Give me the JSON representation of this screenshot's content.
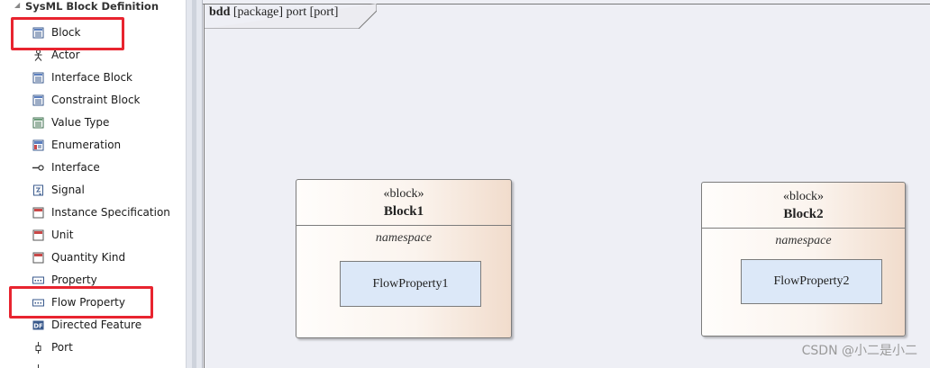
{
  "toolbox": {
    "section_title": "SysML Block Definition",
    "items": [
      {
        "label": "Block",
        "icon": "block-icon"
      },
      {
        "label": "Actor",
        "icon": "actor-icon"
      },
      {
        "label": "Interface Block",
        "icon": "interface-block-icon"
      },
      {
        "label": "Constraint Block",
        "icon": "constraint-block-icon"
      },
      {
        "label": "Value Type",
        "icon": "value-type-icon"
      },
      {
        "label": "Enumeration",
        "icon": "enumeration-icon"
      },
      {
        "label": "Interface",
        "icon": "interface-icon"
      },
      {
        "label": "Signal",
        "icon": "signal-icon"
      },
      {
        "label": "Instance Specification",
        "icon": "instance-specification-icon"
      },
      {
        "label": "Unit",
        "icon": "unit-icon"
      },
      {
        "label": "Quantity Kind",
        "icon": "quantity-kind-icon"
      },
      {
        "label": "Property",
        "icon": "property-icon"
      },
      {
        "label": "Flow Property",
        "icon": "flow-property-icon"
      },
      {
        "label": "Directed Feature",
        "icon": "directed-feature-icon"
      },
      {
        "label": "Port",
        "icon": "port-icon"
      }
    ],
    "highlight_color": "#e8242f"
  },
  "diagram": {
    "frame_kind": "bdd",
    "frame_title": "[package] port [port]",
    "blocks": [
      {
        "stereotype": "«block»",
        "name": "Block1",
        "compartment": "namespace",
        "flow_property": "FlowProperty1"
      },
      {
        "stereotype": "«block»",
        "name": "Block2",
        "compartment": "namespace",
        "flow_property": "FlowProperty2"
      }
    ]
  },
  "watermark": "CSDN @小二是小二"
}
